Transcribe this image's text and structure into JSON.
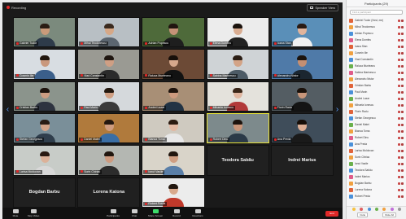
{
  "meeting": {
    "recording_label": "Recording",
    "view_label": "Speaker View"
  },
  "tiles": [
    {
      "name": "Gabriel Tudor",
      "wall": "#7b8a7d",
      "skin": "#c99a7a",
      "shirt": "#2e3b4a",
      "hair": "#2a1d14"
    },
    {
      "name": "Mihai Teodorescu",
      "wall": "#b8bfc4",
      "skin": "#d6a887",
      "shirt": "#5c6670",
      "hair": "#3a2a1e"
    },
    {
      "name": "Adrian Popescu",
      "wall": "#4e6a3a",
      "skin": "#c59277",
      "shirt": "#1e1e1e",
      "hair": "#201510"
    },
    {
      "name": "Elena Dumitru",
      "wall": "#ececec",
      "skin": "#d9ad92",
      "shirt": "#222",
      "hair": "#1a120d"
    },
    {
      "name": "Ioana Stan",
      "wall": "#5a8fb8",
      "skin": "#e0b49c",
      "shirt": "#f0f0f0",
      "hair": "#2a1a12"
    },
    {
      "name": "Cosmin Ilie",
      "wall": "#d8dde2",
      "skin": "#c9987d",
      "shirt": "#3b5f8a",
      "hair": "#22170f"
    },
    {
      "name": "Vlad Constantin",
      "wall": "#9a9a93",
      "skin": "#cf9f84",
      "shirt": "#2b2b2b",
      "hair": "#1f1610"
    },
    {
      "name": "Raluca Munteanu",
      "wall": "#6c4a36",
      "skin": "#d6a88c",
      "shirt": "#121212",
      "hair": "#170f0a"
    },
    {
      "name": "Sabina Marinescu",
      "wall": "#cfd3d6",
      "skin": "#d3a386",
      "shirt": "#4d5b66",
      "hair": "#2a1c13"
    },
    {
      "name": "Alexandru Nistor",
      "wall": "#4f7aa8",
      "skin": "#c58f72",
      "shirt": "#1b2630",
      "hair": "#1c130d"
    },
    {
      "name": "Cristian Barbu",
      "wall": "#8b948c",
      "skin": "#cd9d82",
      "shirt": "#2e3440",
      "hair": "#1e140e"
    },
    {
      "name": "Paul Marin",
      "wall": "#d5d9dc",
      "skin": "#d0a084",
      "shirt": "#3a3a3a",
      "hair": "#23180f"
    },
    {
      "name": "Andrei Lazar",
      "wall": "#a88f76",
      "skin": "#cc9a7e",
      "shirt": "#223344",
      "hair": "#1e140e"
    },
    {
      "name": "Mihaela Ionescu",
      "wall": "#e4e2dc",
      "skin": "#e0b6a0",
      "shirt": "#b23a3a",
      "hair": "#3a2618"
    },
    {
      "name": "Florin Radu",
      "wall": "#545d63",
      "skin": "#c8967a",
      "shirt": "#141414",
      "hair": "#1a110b"
    },
    {
      "name": "Stefan Georgescu",
      "wall": "#7a8f99",
      "skin": "#d4a488",
      "shirt": "#2f3e4c",
      "hair": "#2a1c13"
    },
    {
      "name": "Daniel Matei",
      "wall": "#b07a3c",
      "skin": "#cf9c7f",
      "shirt": "#3a6ea5",
      "hair": "#241810"
    },
    {
      "name": "Bianca Toma",
      "wall": "#cfcac0",
      "skin": "#e2b8a2",
      "shirt": "#e8e8e8",
      "hair": "#2b1a10"
    },
    {
      "name": "Robert Dinu",
      "wall": "#7d8a8c",
      "skin": "#c99579",
      "shirt": "#2b3a48",
      "hair": "#1d130d"
    },
    {
      "name": "Ana Preda",
      "wall": "#3f4d5a",
      "skin": "#dcae94",
      "shirt": "#1a1a1a",
      "hair": "#160e08"
    },
    {
      "name": "Larisa Moldovan",
      "wall": "#c8ccc8",
      "skin": "#dcb199",
      "shirt": "#d8d8d8",
      "hair": "#2a1911"
    },
    {
      "name": "Sorin Chiriac",
      "wall": "#b4b7b2",
      "skin": "#cd9b80",
      "shirt": "#2c2c2c",
      "hair": "#21160f"
    },
    {
      "name": "Ionut Vasile",
      "wall": "#d9d4c9",
      "skin": "#cf9e82",
      "shirt": "#5a7fa8",
      "hair": "#21160f"
    },
    {
      "name": "Teodora Sabău",
      "wall": "#202020",
      "name_only": true
    },
    {
      "name": "Indrei Marius",
      "wall": "#202020",
      "name_only": true
    },
    {
      "name": "Bogdan Barbu",
      "wall": "#202020",
      "name_only": true
    },
    {
      "name": "Lorena Katona",
      "wall": "#202020",
      "name_only": true
    },
    {
      "name": "Robert Preda",
      "wall": "#ececec",
      "skin": "#d8a98c",
      "shirt": "#c0392b",
      "hair": "#22170f"
    }
  ],
  "toolbar": {
    "items": [
      {
        "label": "Mute",
        "icon": "microphone-icon"
      },
      {
        "label": "Stop Video",
        "icon": "video-camera-icon"
      }
    ],
    "center_items": [
      {
        "label": "Participants",
        "icon": "participants-icon"
      },
      {
        "label": "Chat",
        "icon": "chat-icon"
      },
      {
        "label": "Share Screen",
        "icon": "share-screen-icon",
        "accent": "#3ddc6b"
      },
      {
        "label": "Record",
        "icon": "record-icon"
      },
      {
        "label": "Reactions",
        "icon": "reactions-icon"
      }
    ],
    "end_label": "End"
  },
  "panel": {
    "title": "Participants (29)",
    "search_placeholder": "Find a participant",
    "participants": [
      {
        "name": "Gabriel Tudor (Host, me)",
        "color": "#e0633a"
      },
      {
        "name": "Mihai Teodorescu",
        "color": "#f0a040"
      },
      {
        "name": "Adrian Popescu",
        "color": "#4a90d9"
      },
      {
        "name": "Elena Dumitru",
        "color": "#e05c8a"
      },
      {
        "name": "Ioana Stan",
        "color": "#e0633a"
      },
      {
        "name": "Cosmin Ilie",
        "color": "#f0a040"
      },
      {
        "name": "Vlad Constantin",
        "color": "#4a90d9"
      },
      {
        "name": "Raluca Munteanu",
        "color": "#6ab04c"
      },
      {
        "name": "Sabina Marinescu",
        "color": "#e05c8a"
      },
      {
        "name": "Alexandru Nistor",
        "color": "#f0a040"
      },
      {
        "name": "Cristian Barbu",
        "color": "#e0633a"
      },
      {
        "name": "Paul Marin",
        "color": "#4a90d9"
      },
      {
        "name": "Andrei Lazar",
        "color": "#6ab04c"
      },
      {
        "name": "Mihaela Ionescu",
        "color": "#f0a040"
      },
      {
        "name": "Florin Radu",
        "color": "#e0633a"
      },
      {
        "name": "Stefan Georgescu",
        "color": "#4a90d9"
      },
      {
        "name": "Daniel Matei",
        "color": "#6ab04c"
      },
      {
        "name": "Bianca Toma",
        "color": "#f0a040"
      },
      {
        "name": "Robert Dinu",
        "color": "#e05c8a"
      },
      {
        "name": "Ana Preda",
        "color": "#4a90d9"
      },
      {
        "name": "Larisa Moldovan",
        "color": "#e0633a"
      },
      {
        "name": "Sorin Chiriac",
        "color": "#f0a040"
      },
      {
        "name": "Ionut Vasile",
        "color": "#6ab04c"
      },
      {
        "name": "Teodora Sabău",
        "color": "#4a90d9"
      },
      {
        "name": "Indrei Marius",
        "color": "#e05c8a"
      },
      {
        "name": "Bogdan Barbu",
        "color": "#f0a040"
      },
      {
        "name": "Lorena Katona",
        "color": "#e0633a"
      },
      {
        "name": "Robert Preda",
        "color": "#4a90d9"
      }
    ],
    "reaction_colors": [
      "#f5c242",
      "#e06060",
      "#4a90d9",
      "#6ab04c",
      "#f0a040",
      "#c06fd9",
      "#999999"
    ],
    "invite_label": "Invite",
    "mute_all_label": "Mute All"
  },
  "colors": {
    "speaker_border": "#e8e236",
    "end_red": "#e02828",
    "arrow_blue": "#5aa0ff"
  }
}
